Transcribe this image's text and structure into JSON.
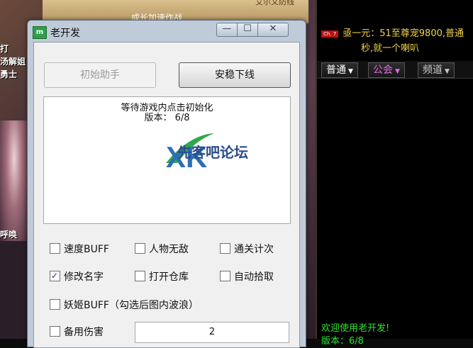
{
  "game": {
    "banner_tab": "成长加速作战",
    "banner_text": "艾尔文防线",
    "left_labels": [
      "打",
      "汤解姐",
      "勇士",
      "呼唤"
    ]
  },
  "chat": {
    "badge": "Ch. 7",
    "message_line1": "亟一元：51至尊宠9800,普通",
    "message_line2": "秒,就一个喇叭",
    "tabs": [
      {
        "label": "普通",
        "color": "#ffffff"
      },
      {
        "label": "公会",
        "color": "#e36be3"
      },
      {
        "label": "频道",
        "color": "#c9c9c9"
      }
    ],
    "welcome": "欢迎使用老开发!",
    "version_partial": "版本：6/8"
  },
  "window": {
    "icon_label": "m",
    "title": "老开发",
    "buttons": {
      "minimize": "—",
      "maximize": "☐",
      "close": "✕"
    }
  },
  "controls": {
    "init_button": "初始助手",
    "offline_button": "安稳下线"
  },
  "log": {
    "line1": "等待游戏内点击初始化",
    "line2": "版本：  6/8"
  },
  "watermark": {
    "logo": "XK",
    "text": "先客吧论坛",
    "colors": {
      "green": "#2ea84a",
      "blue": "#2b6fb5"
    }
  },
  "options": [
    {
      "label": "速度BUFF",
      "checked": false
    },
    {
      "label": "人物无敌",
      "checked": false
    },
    {
      "label": "通关计次",
      "checked": false
    },
    {
      "label": "修改名字",
      "checked": true
    },
    {
      "label": "打开仓库",
      "checked": false
    },
    {
      "label": "自动拾取",
      "checked": false
    },
    {
      "label": "妖姬BUFF（勾选后图内波浪）",
      "checked": false
    },
    {
      "label": "备用伤害",
      "checked": false
    }
  ],
  "damage_input": {
    "value": "2"
  }
}
